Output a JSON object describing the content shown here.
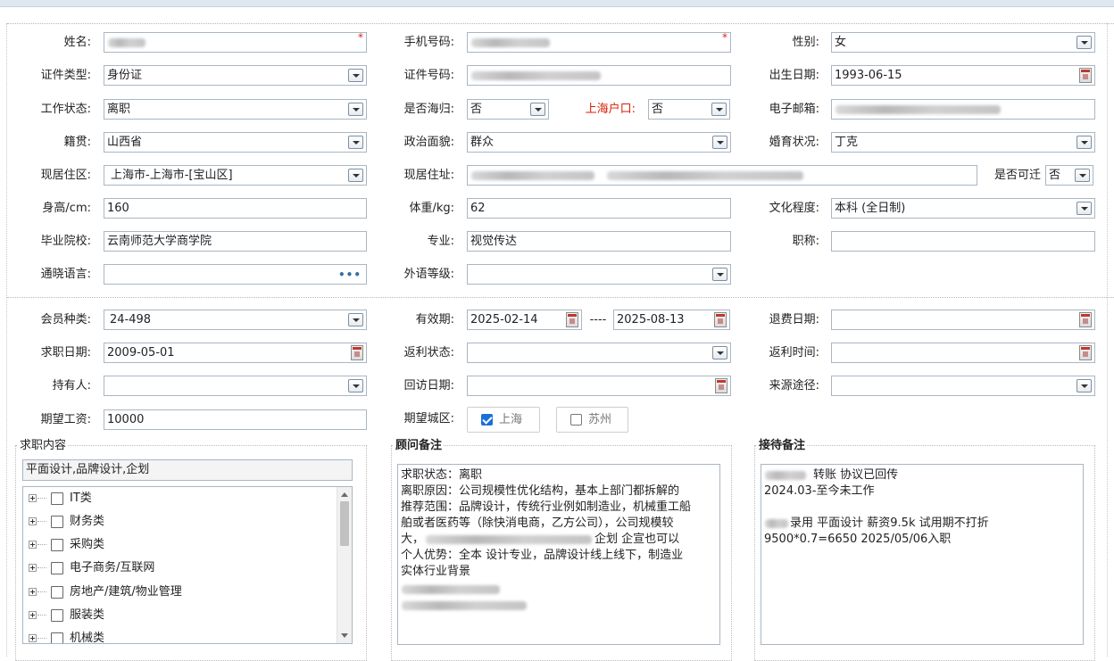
{
  "section1": {
    "name": {
      "label": "姓名:",
      "value": "",
      "required": "*"
    },
    "phone": {
      "label": "手机号码:",
      "value": "",
      "required": "*"
    },
    "gender": {
      "label": "性别:",
      "value": "女"
    },
    "id_type": {
      "label": "证件类型:",
      "value": "身份证"
    },
    "id_number": {
      "label": "证件号码:",
      "value": ""
    },
    "birth_date": {
      "label": "出生日期:",
      "value": "1993-06-15"
    },
    "work_status": {
      "label": "工作状态:",
      "value": "离职"
    },
    "overseas": {
      "label": "是否海归:",
      "value": "否"
    },
    "shanghai_hukou": {
      "label": "上海户口:",
      "value": "否"
    },
    "email": {
      "label": "电子邮箱:",
      "value": ""
    },
    "native_place": {
      "label": "籍贯:",
      "value": "山西省"
    },
    "political": {
      "label": "政治面貌:",
      "value": "群众"
    },
    "marital": {
      "label": "婚育状况:",
      "value": "丁克"
    },
    "residence_area": {
      "label": "现居住区:",
      "value": "上海市-上海市-[宝山区]"
    },
    "residence_address": {
      "label": "现居住址:",
      "value": ""
    },
    "movable": {
      "label": "是否可迁",
      "value": "否"
    },
    "height": {
      "label": "身高/cm:",
      "value": "160"
    },
    "weight": {
      "label": "体重/kg:",
      "value": "62"
    },
    "education": {
      "label": "文化程度:",
      "value": "本科 (全日制)"
    },
    "school": {
      "label": "毕业院校:",
      "value": "云南师范大学商学院"
    },
    "major": {
      "label": "专业:",
      "value": "视觉传达"
    },
    "title": {
      "label": "职称:",
      "value": ""
    },
    "language": {
      "label": "通晓语言:",
      "value": "",
      "more": "•••"
    },
    "foreign_level": {
      "label": "外语等级:",
      "value": ""
    }
  },
  "section2": {
    "member_type": {
      "label": "会员种类:",
      "value": "24-498"
    },
    "valid_period": {
      "label": "有效期:",
      "start": "2025-02-14",
      "sep": "----",
      "end": "2025-08-13"
    },
    "refund_date": {
      "label": "退费日期:",
      "value": ""
    },
    "job_date": {
      "label": "求职日期:",
      "value": "2009-05-01"
    },
    "rebate_status": {
      "label": "返利状态:",
      "value": ""
    },
    "rebate_time": {
      "label": "返利时间:",
      "value": ""
    },
    "holder": {
      "label": "持有人:",
      "value": ""
    },
    "visit_date": {
      "label": "回访日期:",
      "value": ""
    },
    "source": {
      "label": "来源途径:",
      "value": ""
    },
    "expected_salary": {
      "label": "期望工资:",
      "value": "10000"
    },
    "expected_city": {
      "label": "期望城区:",
      "options": [
        {
          "label": "上海",
          "checked": true
        },
        {
          "label": "苏州",
          "checked": false
        }
      ]
    }
  },
  "job_content": {
    "legend": "求职内容",
    "selected": "平面设计,品牌设计,企划",
    "tree": [
      "IT类",
      "财务类",
      "采购类",
      "电子商务/互联网",
      "房地产/建筑/物业管理",
      "服装类",
      "机械类"
    ]
  },
  "consultant_notes": {
    "legend": "顾问备注",
    "lines": [
      "求职状态：离职",
      "离职原因：公司规模性优化结构，基本上部门都拆解的",
      "推荐范围：品牌设计，传统行业例如制造业，机械重工船",
      "舶或者医药等（除快消电商，乙方公司），公司规模较",
      "大，",
      "个人优势：全本 设计专业，品牌设计线上线下，制造业",
      "实体行业背景"
    ],
    "line5_tail": "企划 企宣也可以"
  },
  "reception_notes": {
    "legend": "接待备注",
    "line1": "转账  协议已回传",
    "line2": "2024.03-至今未工作",
    "line3": "录用 平面设计 薪资9.5k 试用期不打折",
    "line4": "9500*0.7=6650 2025/05/06入职"
  },
  "colors": {
    "accent_red": "#d81e06",
    "checkbox_blue": "#1c6fd8",
    "border": "#a9b6c2"
  }
}
